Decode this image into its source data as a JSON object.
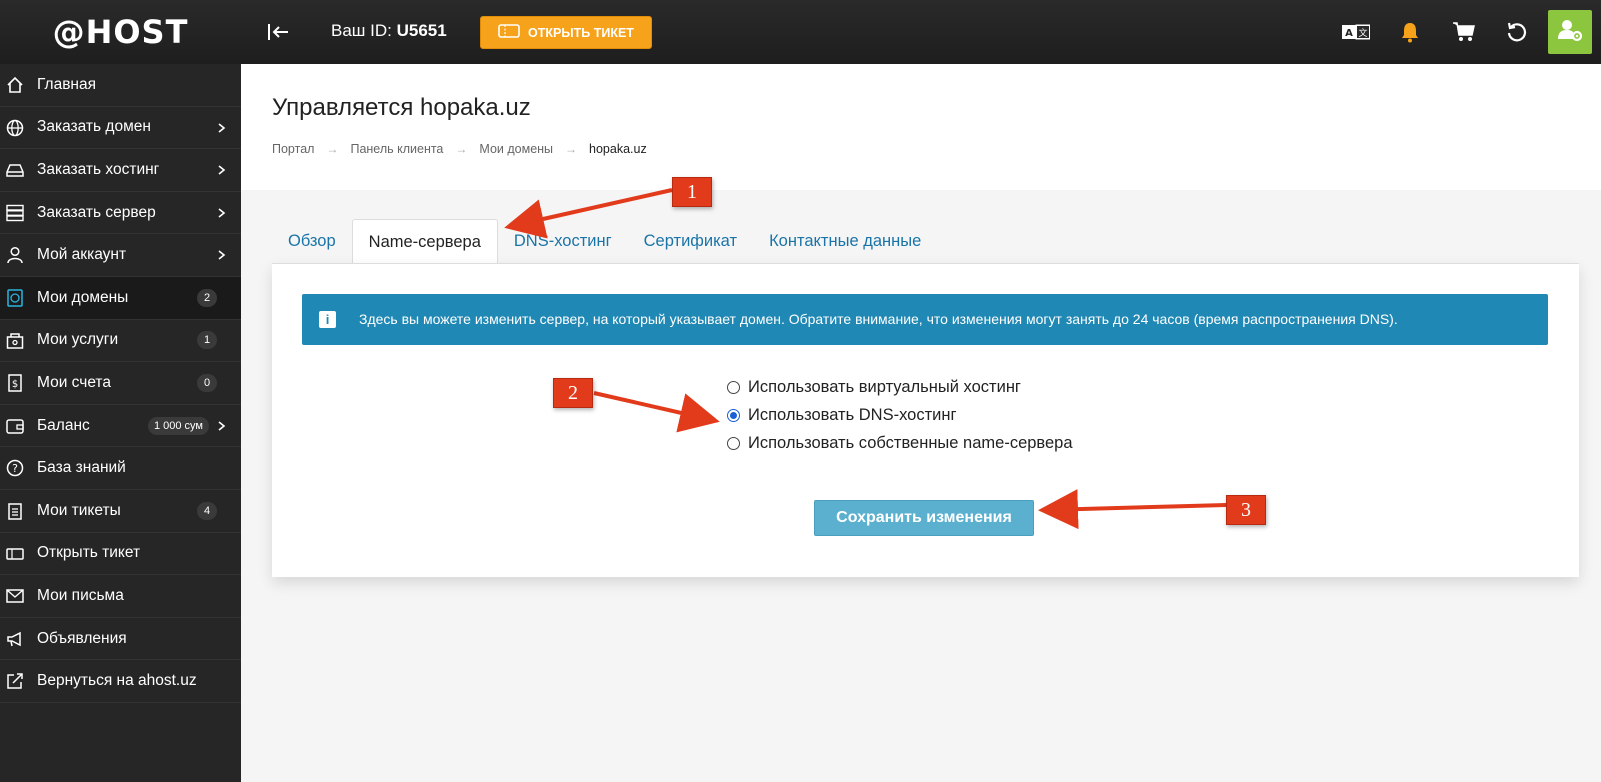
{
  "header": {
    "logo": "@HOST",
    "user_id_label": "Ваш ID:",
    "user_id_value": "U5651",
    "ticket_button": "ОТКРЫТЬ ТИКЕТ",
    "translate_icon_text": "A文"
  },
  "sidebar": {
    "items": [
      {
        "label": "Главная",
        "icon": "home-icon"
      },
      {
        "label": "Заказать домен",
        "icon": "globe-icon"
      },
      {
        "label": "Заказать хостинг",
        "icon": "drive-icon"
      },
      {
        "label": "Заказать сервер",
        "icon": "server-icon"
      },
      {
        "label": "Мой аккаунт",
        "icon": "user-icon"
      },
      {
        "label": "Мои домены",
        "icon": "domains-icon",
        "badge": "2"
      },
      {
        "label": "Мои услуги",
        "icon": "box-icon",
        "badge": "1"
      },
      {
        "label": "Мои счета",
        "icon": "invoice-icon",
        "badge": "0"
      },
      {
        "label": "Баланс",
        "icon": "wallet-icon",
        "badge": "1 000 сум"
      },
      {
        "label": "База знаний",
        "icon": "help-icon"
      },
      {
        "label": "Мои тикеты",
        "icon": "tickets-icon",
        "badge": "4"
      },
      {
        "label": "Открыть тикет",
        "icon": "ticket-icon"
      },
      {
        "label": "Мои письма",
        "icon": "mail-icon"
      },
      {
        "label": "Объявления",
        "icon": "megaphone-icon"
      },
      {
        "label": "Вернуться на ahost.uz",
        "icon": "external-link-icon"
      }
    ]
  },
  "page": {
    "title": "Управляется hopaka.uz",
    "breadcrumb": [
      "Портал",
      "Панель клиента",
      "Мои домены",
      "hopaka.uz"
    ]
  },
  "tabs": [
    "Обзор",
    "Name-сервера",
    "DNS-хостинг",
    "Сертификат",
    "Контактные данные"
  ],
  "alert": {
    "icon_text": "i",
    "text": "Здесь вы можете изменить сервер, на который указывает домен. Обратите внимание, что изменения могут занять до 24 часов (время распространения DNS)."
  },
  "options": [
    {
      "label": "Использовать виртуальный хостинг",
      "checked": false
    },
    {
      "label": "Использовать DNS-хостинг",
      "checked": true
    },
    {
      "label": "Использовать собственные name-сервера",
      "checked": false
    }
  ],
  "save_button": "Сохранить изменения",
  "annotations": [
    "1",
    "2",
    "3"
  ],
  "colors": {
    "accent_orange": "#f7a21b",
    "alert_blue": "#1f88b4",
    "button_blue": "#5bb0d0",
    "profile_green": "#8cc63f",
    "annotation_red": "#e23b1c"
  }
}
